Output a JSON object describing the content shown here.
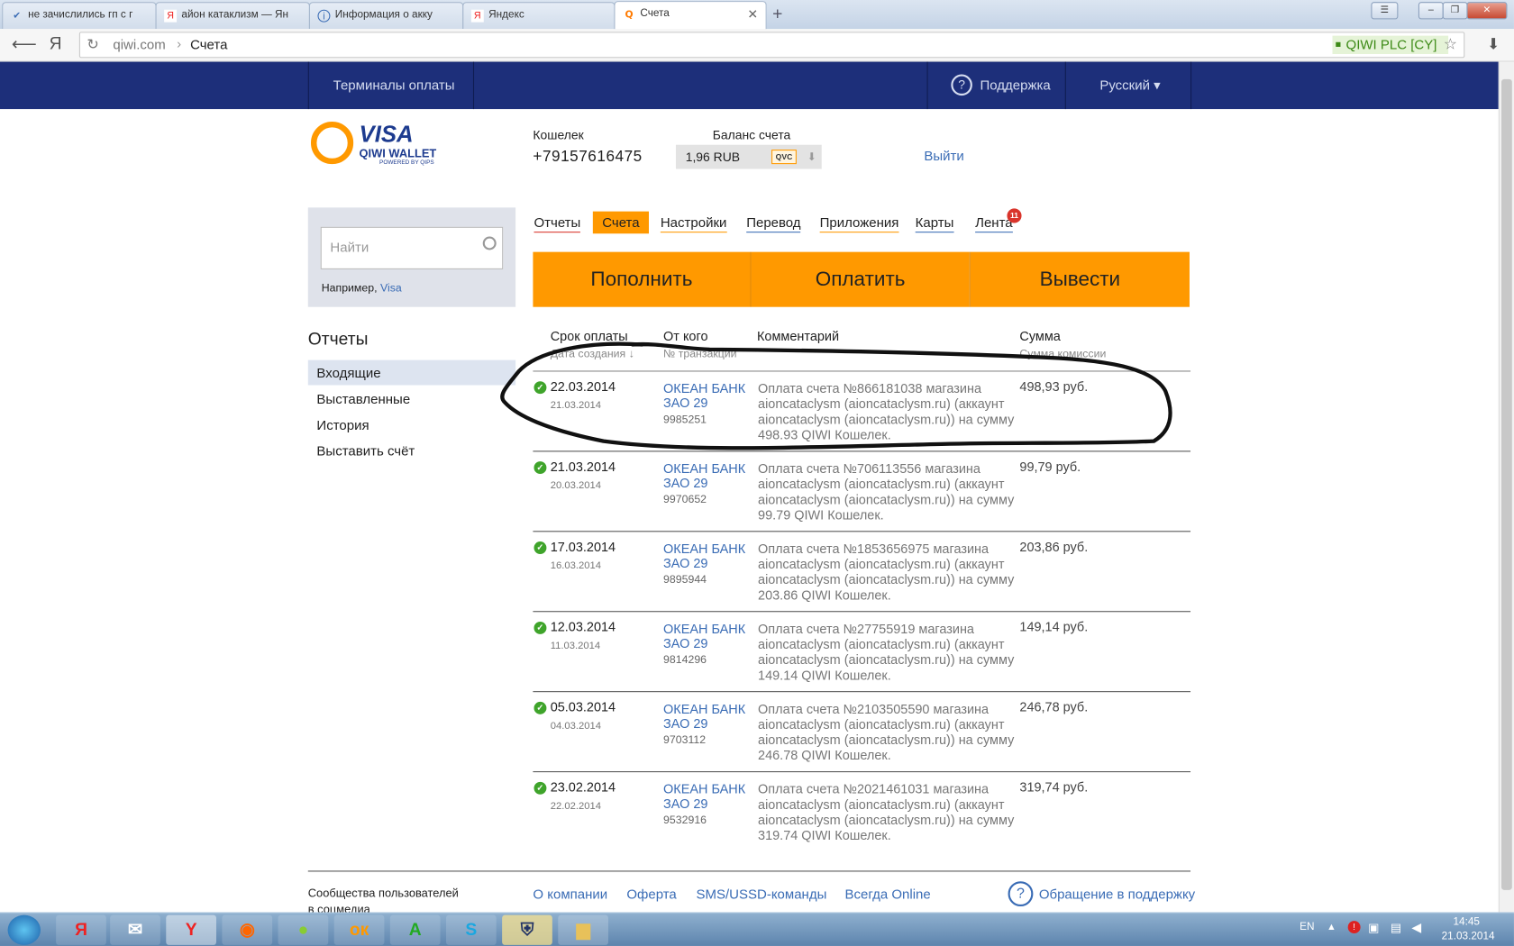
{
  "browser": {
    "tabs": [
      {
        "title": "не зачислились гп с г",
        "icon": "checkmark-favicon"
      },
      {
        "title": "айон катаклизм — Ян",
        "icon": "yandex-favicon",
        "icon_text": "Я"
      },
      {
        "title": "Информация о акку",
        "icon": "info-favicon"
      },
      {
        "title": "Яндекс",
        "icon": "yandex-favicon",
        "icon_text": "Я"
      },
      {
        "title": "Счета",
        "icon": "qiwi-favicon",
        "icon_text": "Q"
      }
    ],
    "new_tab": "+",
    "yandex_logo": "Я",
    "url_domain": "qiwi.com",
    "url_sep": "›",
    "url_page": "Счета",
    "ssl_label": "QIWI PLC [CY]",
    "star": "☆",
    "download": "⬇"
  },
  "site": {
    "nav": {
      "terminals": "Терминалы оплаты",
      "support_icon": "?",
      "support": "Поддержка",
      "language": "Русский ▾"
    },
    "logo": {
      "visa": "VISA",
      "qiwi": "QIWI WALLET",
      "powered": "POWERED BY QIPS",
      "letter": "Q"
    },
    "wallet": {
      "label": "Кошелек",
      "number": "+79157616475"
    },
    "balance": {
      "label": "Баланс счета",
      "value": "1,96 RUB",
      "badge": "QVC",
      "arrow": "⬇"
    },
    "logout": "Выйти",
    "search": {
      "placeholder": "Найти",
      "example_prefix": "Например,",
      "example_link": "Visa"
    },
    "tabs": [
      {
        "label": "Отчеты",
        "color": "#d9342b"
      },
      {
        "label": "Счета",
        "active": true
      },
      {
        "label": "Настройки",
        "color": "#ff9900"
      },
      {
        "label": "Перевод",
        "color": "#3a6cb5"
      },
      {
        "label": "Приложения",
        "color": "#ff9900"
      },
      {
        "label": "Карты",
        "color": "#3a6cb5"
      },
      {
        "label": "Лента",
        "color": "#3a6cb5",
        "badge": "11"
      }
    ],
    "actions": [
      "Пополнить",
      "Оплатить",
      "Вывести"
    ],
    "sidebar": {
      "title": "Отчеты",
      "items": [
        "Входящие",
        "Выставленные",
        "История",
        "Выставить счёт"
      ]
    },
    "table": {
      "headers": {
        "due": "Срок оплаты",
        "created": "Дата создания ↓",
        "from": "От кого",
        "trx": "№ транзакции",
        "comment": "Комментарий",
        "sum": "Сумма",
        "commission": "Сумма комиссии"
      },
      "rows": [
        {
          "date": "22.03.2014",
          "created": "21.03.2014",
          "from": "ОКЕАН БАНК ЗАО 29",
          "trx": "9985251",
          "comment": "Оплата счета №866181038 магазина aioncataclysm (aioncataclysm.ru) (аккаунт aioncataclysm (aioncataclysm.ru)) на сумму 498.93 QIWI Кошелек.",
          "sum": "498,93 руб."
        },
        {
          "date": "21.03.2014",
          "created": "20.03.2014",
          "from": "ОКЕАН БАНК ЗАО 29",
          "trx": "9970652",
          "comment": "Оплата счета №706113556 магазина aioncataclysm (aioncataclysm.ru) (аккаунт aioncataclysm (aioncataclysm.ru)) на сумму 99.79 QIWI Кошелек.",
          "sum": "99,79 руб."
        },
        {
          "date": "17.03.2014",
          "created": "16.03.2014",
          "from": "ОКЕАН БАНК ЗАО 29",
          "trx": "9895944",
          "comment": "Оплата счета №1853656975 магазина aioncataclysm (aioncataclysm.ru) (аккаунт aioncataclysm (aioncataclysm.ru)) на сумму 203.86 QIWI Кошелек.",
          "sum": "203,86 руб."
        },
        {
          "date": "12.03.2014",
          "created": "11.03.2014",
          "from": "ОКЕАН БАНК ЗАО 29",
          "trx": "9814296",
          "comment": "Оплата счета №27755919 магазина aioncataclysm (aioncataclysm.ru) (аккаунт aioncataclysm (aioncataclysm.ru)) на сумму 149.14 QIWI Кошелек.",
          "sum": "149,14 руб."
        },
        {
          "date": "05.03.2014",
          "created": "04.03.2014",
          "from": "ОКЕАН БАНК ЗАО 29",
          "trx": "9703112",
          "comment": "Оплата счета №2103505590 магазина aioncataclysm (aioncataclysm.ru) (аккаунт aioncataclysm (aioncataclysm.ru)) на сумму 246.78 QIWI Кошелек.",
          "sum": "246,78 руб."
        },
        {
          "date": "23.02.2014",
          "created": "22.02.2014",
          "from": "ОКЕАН БАНК ЗАО 29",
          "trx": "9532916",
          "comment": "Оплата счета №2021461031 магазина aioncataclysm (aioncataclysm.ru) (аккаунт aioncataclysm (aioncataclysm.ru)) на сумму 319.74 QIWI Кошелек.",
          "sum": "319,74 руб."
        }
      ]
    },
    "footer": {
      "community": "Сообщества пользователей в соцмедиа",
      "links": [
        "О компании",
        "Оферта",
        "SMS/USSD-команды",
        "Всегда Online"
      ],
      "support_icon": "?",
      "support": "Обращение в поддержку"
    }
  },
  "taskbar": {
    "lang": "EN",
    "time": "14:45",
    "date": "21.03.2014",
    "yandex": "Я",
    "ok": "ок",
    "a": "A",
    "skype": "S"
  },
  "colors": {
    "nav": "#1d2f7a",
    "accent": "#ff9900",
    "link": "#3a6cb5"
  }
}
